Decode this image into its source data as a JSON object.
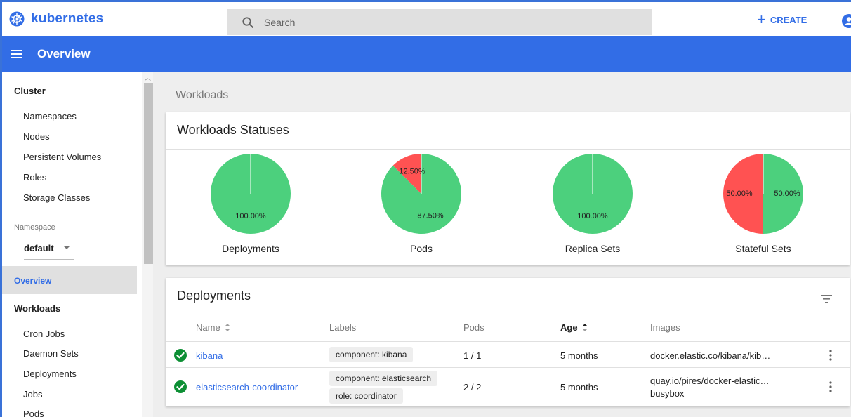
{
  "app": {
    "name": "kubernetes",
    "logo_icon": "kubernetes-logo-icon"
  },
  "search": {
    "placeholder": "Search"
  },
  "header": {
    "create_label": "CREATE",
    "account_icon": "account-circle-icon"
  },
  "titlebar": {
    "title": "Overview"
  },
  "sidebar": {
    "cluster": {
      "heading": "Cluster",
      "items": [
        "Namespaces",
        "Nodes",
        "Persistent Volumes",
        "Roles",
        "Storage Classes"
      ]
    },
    "namespace": {
      "label": "Namespace",
      "value": "default"
    },
    "overview": "Overview",
    "workloads": {
      "heading": "Workloads",
      "items": [
        "Cron Jobs",
        "Daemon Sets",
        "Deployments",
        "Jobs",
        "Pods"
      ]
    }
  },
  "breadcrumb": "Workloads",
  "statuses": {
    "title": "Workloads Statuses",
    "colors": {
      "running": "#4cd07d",
      "failed": "#ff5252"
    },
    "charts": [
      {
        "name": "Deployments",
        "running_pct": 100,
        "failed_pct": 0,
        "running_label": "100.00%",
        "failed_label": ""
      },
      {
        "name": "Pods",
        "running_pct": 87.5,
        "failed_pct": 12.5,
        "running_label": "87.50%",
        "failed_label": "12.50%"
      },
      {
        "name": "Replica Sets",
        "running_pct": 100,
        "failed_pct": 0,
        "running_label": "100.00%",
        "failed_label": ""
      },
      {
        "name": "Stateful Sets",
        "running_pct": 50,
        "failed_pct": 50,
        "running_label": "50.00%",
        "failed_label": "50.00%"
      }
    ]
  },
  "deployments": {
    "title": "Deployments",
    "columns": {
      "name": "Name",
      "labels": "Labels",
      "pods": "Pods",
      "age": "Age",
      "images": "Images"
    },
    "rows": [
      {
        "name": "kibana",
        "labels": [
          "component: kibana"
        ],
        "pods": "1 / 1",
        "age": "5 months",
        "images": [
          "docker.elastic.co/kibana/kib…"
        ]
      },
      {
        "name": "elasticsearch-coordinator",
        "labels": [
          "component: elasticsearch",
          "role: coordinator"
        ],
        "pods": "2 / 2",
        "age": "5 months",
        "images": [
          "quay.io/pires/docker-elastic…",
          "busybox"
        ]
      }
    ]
  }
}
